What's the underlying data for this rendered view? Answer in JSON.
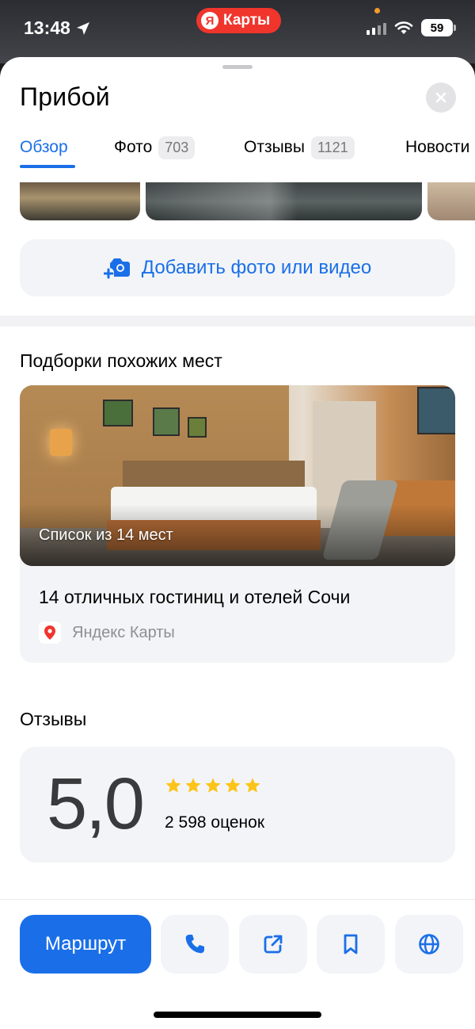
{
  "status_bar": {
    "time": "13:48",
    "app_pill": "Карты",
    "app_pill_logo": "Я",
    "battery": "59"
  },
  "header": {
    "title": "Прибой"
  },
  "tabs": [
    {
      "label": "Обзор",
      "count": ""
    },
    {
      "label": "Фото",
      "count": "703"
    },
    {
      "label": "Отзывы",
      "count": "1121"
    },
    {
      "label": "Новости",
      "count": ""
    }
  ],
  "add_photo": {
    "label": "Добавить фото или видео",
    "icon": "camera-plus-icon"
  },
  "collections": {
    "heading": "Подборки похожих мест",
    "card": {
      "image_label": "Список из 14 мест",
      "title": "14 отличных гостиниц и отелей Сочи",
      "source": "Яндекс Карты"
    }
  },
  "reviews": {
    "heading": "Отзывы",
    "score": "5,0",
    "stars": 5,
    "count_text": "2 598 оценок"
  },
  "actions": {
    "route_label": "Маршрут",
    "buttons": [
      "phone-icon",
      "share-icon",
      "bookmark-icon",
      "globe-icon"
    ]
  },
  "colors": {
    "accent": "#1a6fe8",
    "star": "#fcc419",
    "pill": "#f0352c"
  }
}
